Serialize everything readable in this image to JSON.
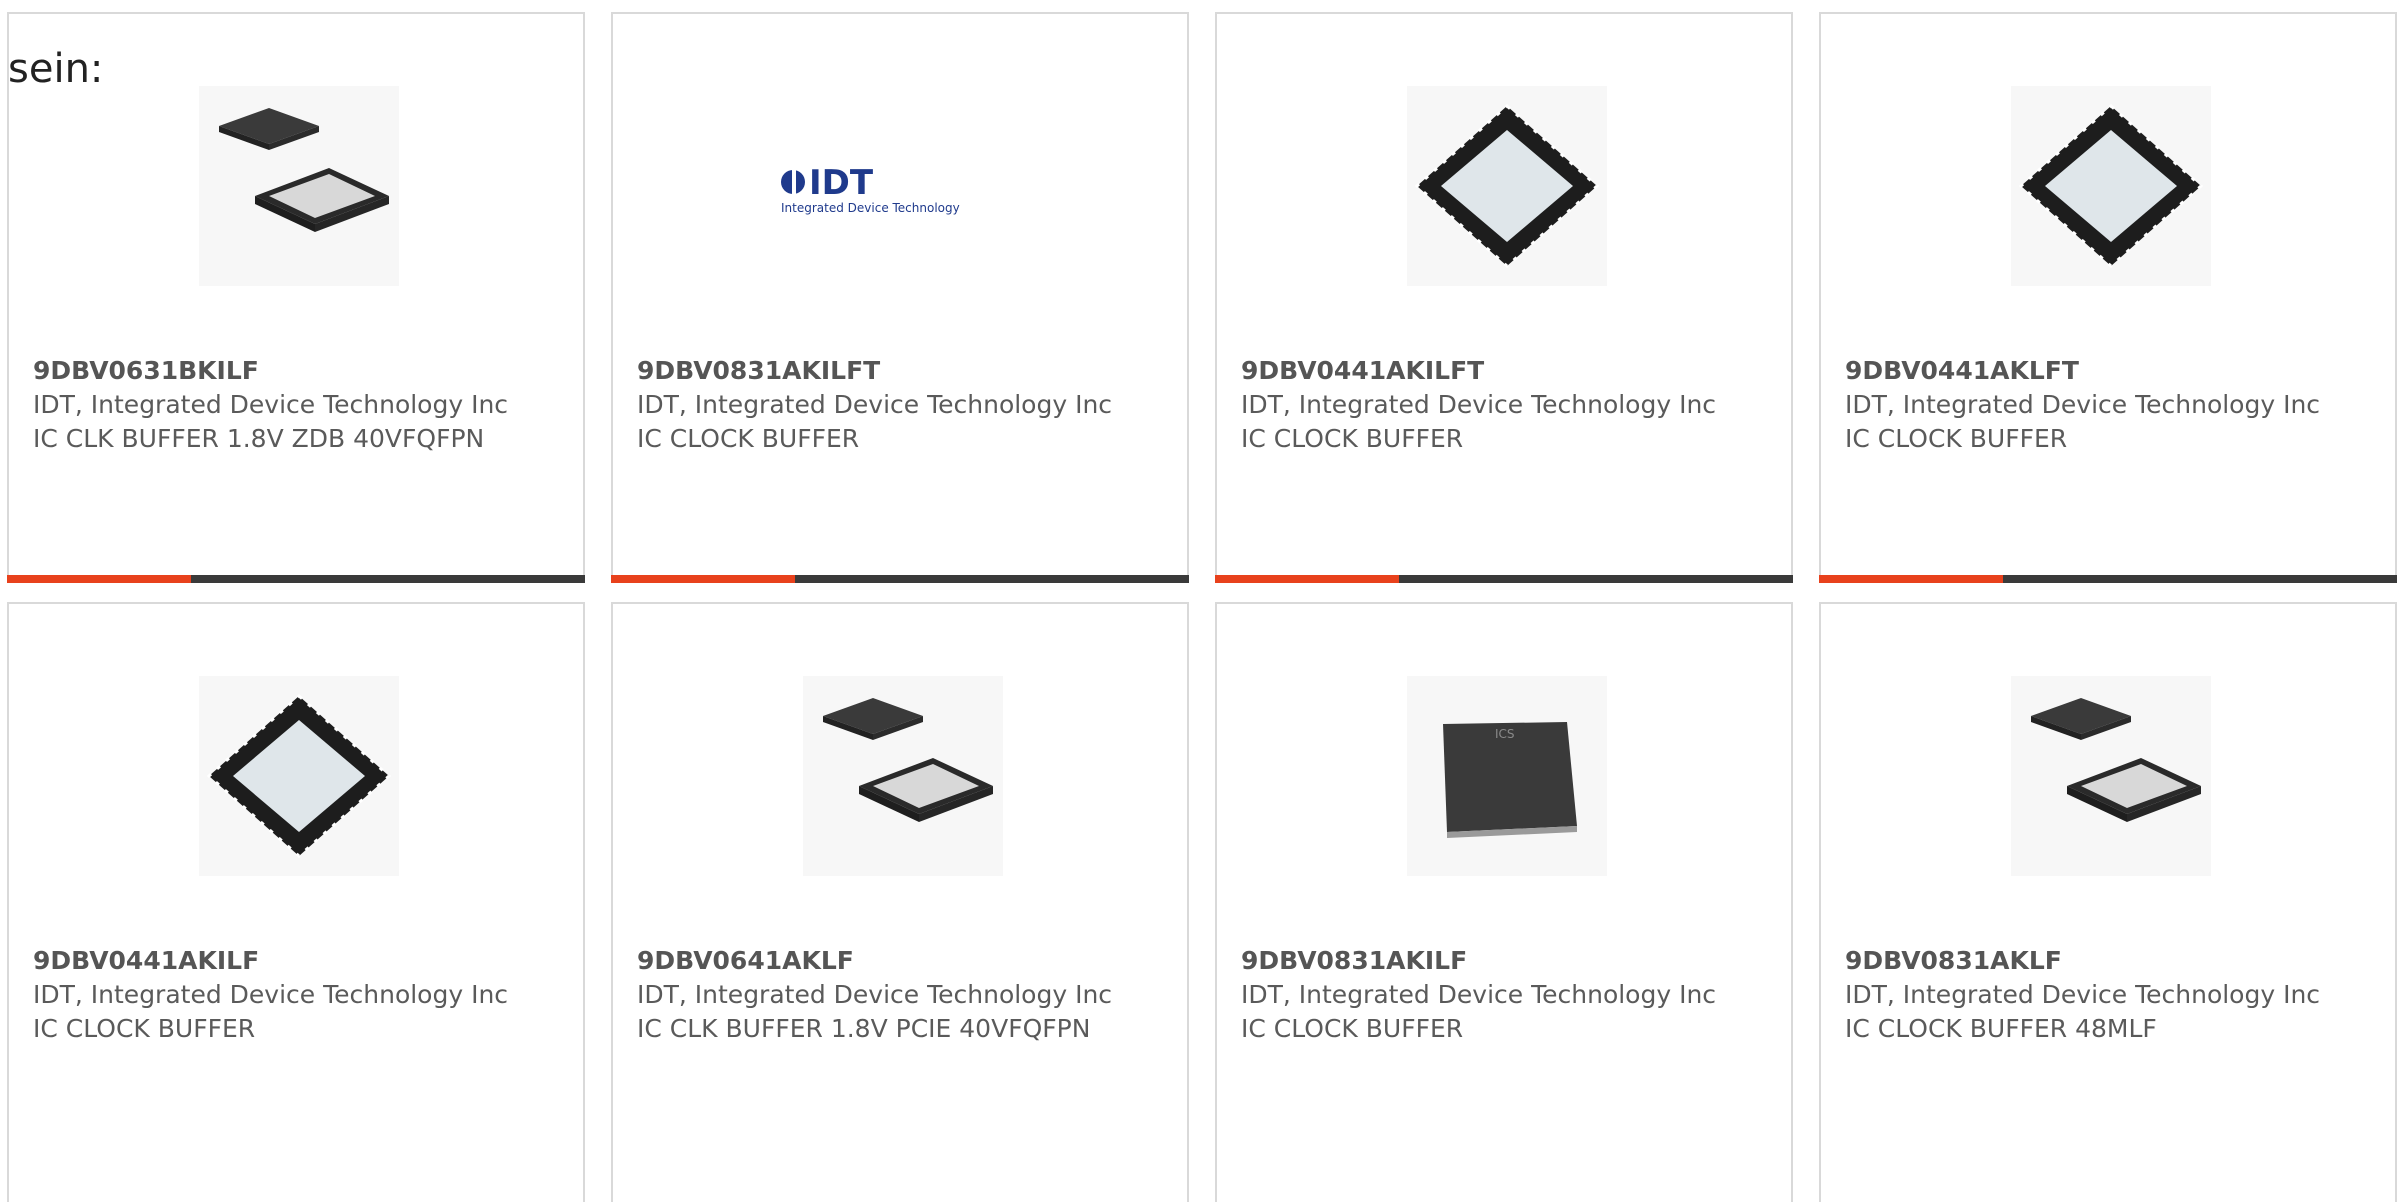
{
  "page": {
    "intro_text": "sein:"
  },
  "colors": {
    "accent": "#e8411c",
    "bar_dark": "#3a3a3a",
    "card_border": "#d9d9d9",
    "text": "#5a5a5a"
  },
  "products": [
    {
      "part_number": "9DBV0631BKILF",
      "manufacturer": "IDT, Integrated Device Technology Inc",
      "description": "IC CLK BUFFER 1.8V ZDB 40VFQFPN",
      "image": "chip-exploded-qfn"
    },
    {
      "part_number": "9DBV0831AKILFT",
      "manufacturer": "IDT, Integrated Device Technology Inc",
      "description": "IC CLOCK BUFFER",
      "image": "idt-logo",
      "logo_text": "IDT",
      "logo_subtext": "Integrated Device Technology"
    },
    {
      "part_number": "9DBV0441AKILFT",
      "manufacturer": "IDT, Integrated Device Technology Inc",
      "description": "IC CLOCK BUFFER",
      "image": "chip-qfn-top"
    },
    {
      "part_number": "9DBV0441AKLFT",
      "manufacturer": "IDT, Integrated Device Technology Inc",
      "description": "IC CLOCK BUFFER",
      "image": "chip-qfn-top"
    },
    {
      "part_number": "9DBV0441AKILF",
      "manufacturer": "IDT, Integrated Device Technology Inc",
      "description": "IC CLOCK BUFFER",
      "image": "chip-qfn-top"
    },
    {
      "part_number": "9DBV0641AKLF",
      "manufacturer": "IDT, Integrated Device Technology Inc",
      "description": "IC CLK BUFFER 1.8V PCIE 40VFQFPN",
      "image": "chip-exploded-qfn"
    },
    {
      "part_number": "9DBV0831AKILF",
      "manufacturer": "IDT, Integrated Device Technology Inc",
      "description": "IC CLOCK BUFFER",
      "image": "chip-ics-dark",
      "chip_marking": "ICS"
    },
    {
      "part_number": "9DBV0831AKLF",
      "manufacturer": "IDT, Integrated Device Technology Inc",
      "description": "IC CLOCK BUFFER 48MLF",
      "image": "chip-exploded-qfn"
    }
  ]
}
